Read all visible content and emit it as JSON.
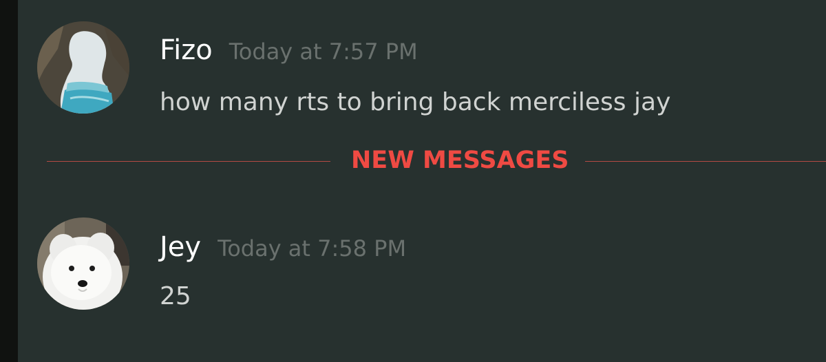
{
  "messages": [
    {
      "author": "Fizo",
      "timestamp": "Today at 7:57 PM",
      "content": "how many rts to bring back merciless jay",
      "avatar": "cave-silhouette-avatar"
    },
    {
      "author": "Jey",
      "timestamp": "Today at 7:58 PM",
      "content": "25",
      "avatar": "white-dog-avatar"
    }
  ],
  "divider": {
    "label": "NEW MESSAGES"
  },
  "colors": {
    "background": "#27312f",
    "author": "#ffffff",
    "timestamp": "#6a716e",
    "content": "#d0d3d1",
    "new_messages_accent": "#ef4a43"
  }
}
